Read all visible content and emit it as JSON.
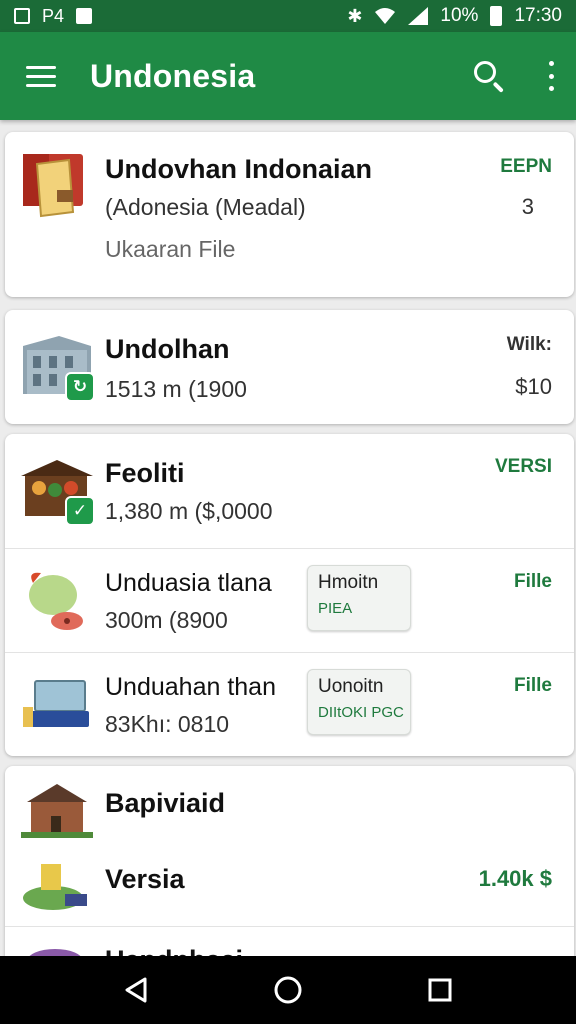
{
  "status_bar": {
    "left_text": "P4",
    "battery": "10%",
    "time": "17:30"
  },
  "toolbar": {
    "title": "Undonesia"
  },
  "items": [
    {
      "title": "Undovhan Indonaian",
      "subtitle": "(Adonesia (Meadal)",
      "detail": "Ukaaran File",
      "side_label": "EEPN",
      "side_value": "3"
    },
    {
      "title": "Undolhan",
      "subtitle": "1513 m (1900",
      "side_label": "Wilk:",
      "side_value": "$10"
    },
    {
      "title": "Feoliti",
      "subtitle": "1,380 m ($,0000",
      "side_label": "VERSI"
    },
    {
      "title": "Unduasia tlana",
      "subtitle": "300m (8900",
      "chip_line1": "Hmoitn",
      "chip_line2": "PIEA",
      "side_label": "Fille"
    },
    {
      "title": "Unduahan than",
      "subtitle": "83Khı: 0810",
      "chip_line1": "Uonoitn",
      "chip_line2": "DIItOKI PGC",
      "side_label": "Fille"
    },
    {
      "title": "Bapiviaid"
    },
    {
      "title": "Versia",
      "side_label": "1.40k $"
    },
    {
      "title": "Uepdnhaai"
    }
  ],
  "icons": {
    "menu": "menu-icon",
    "search": "search-icon",
    "overflow": "more-vert-icon",
    "back": "back-icon",
    "home": "home-icon",
    "recents": "recents-icon"
  },
  "colors": {
    "primary": "#1f8a45",
    "primary_dark": "#1b6b37",
    "accent_text": "#1f7a3e"
  }
}
